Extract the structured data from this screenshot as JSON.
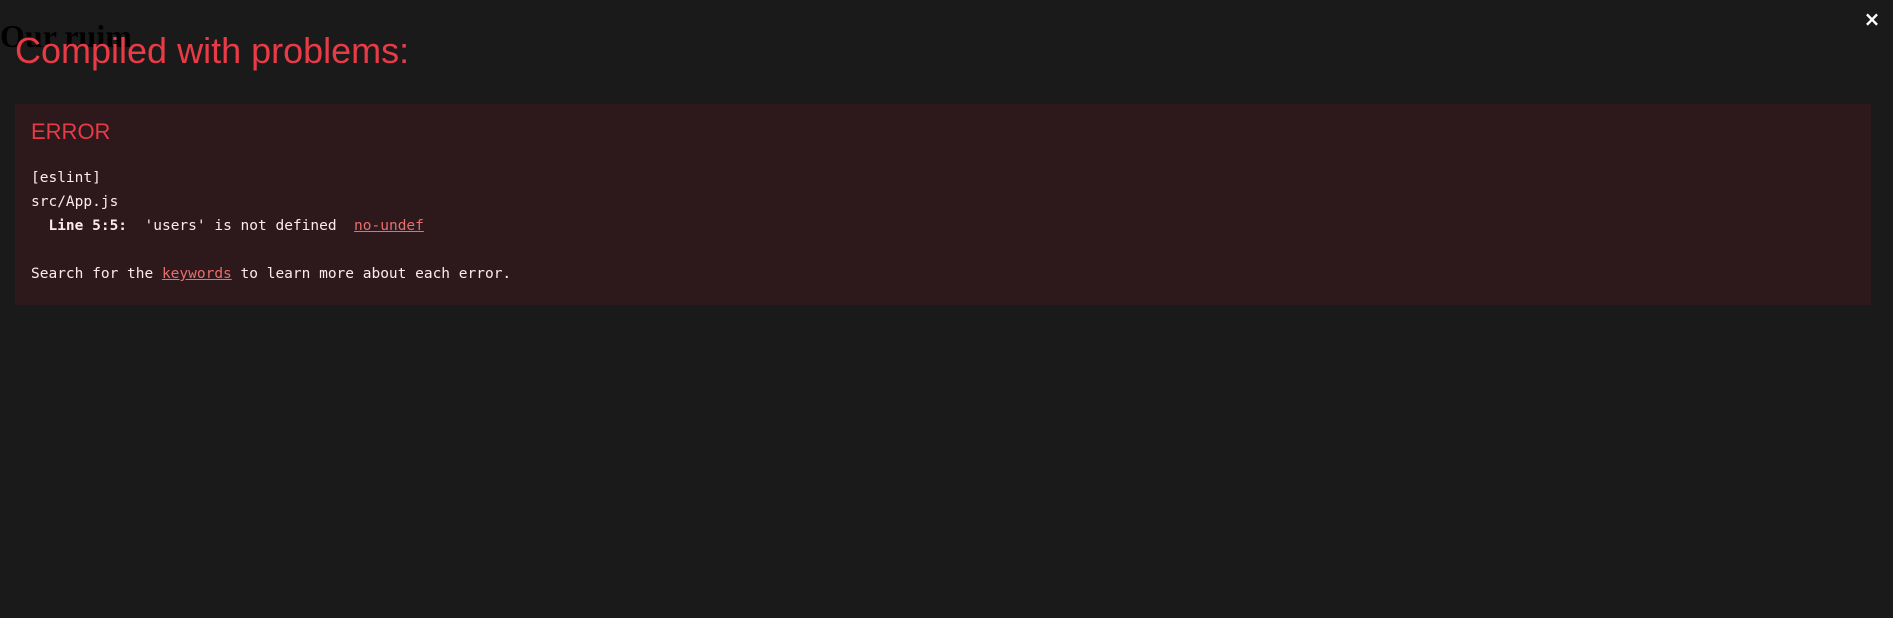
{
  "underlay": {
    "heading": "Our ruim"
  },
  "overlay": {
    "close_symbol": "×",
    "title": "Compiled with problems:",
    "error": {
      "label": "ERROR",
      "source_tag": "[eslint]",
      "file": "src/App.js",
      "line_prefix": "  ",
      "line_location": "Line 5:5:",
      "line_gap": "  ",
      "message": "'users' is not defined",
      "message_gap": "  ",
      "rule": "no-undef",
      "hint_before": "Search for the ",
      "hint_link": "keywords",
      "hint_after": " to learn more about each error."
    }
  },
  "colors": {
    "background": "#1a1a1a",
    "error_red": "#e83b46",
    "panel_bg": "#2d181b",
    "text": "#fcebec",
    "link": "#e96e6e"
  },
  "icons": {
    "close": "close-icon"
  }
}
